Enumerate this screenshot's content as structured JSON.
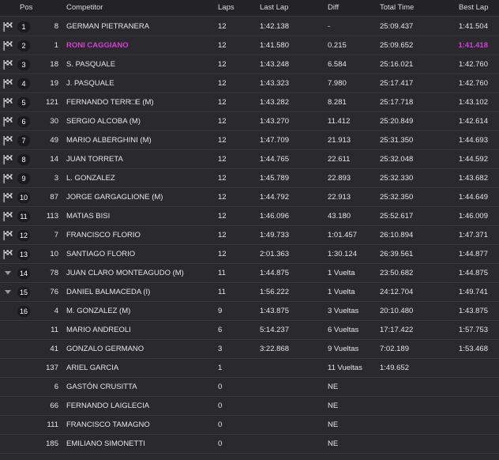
{
  "header": {
    "pos": "Pos",
    "competitor": "Competitor",
    "laps": "Laps",
    "last_lap": "Last Lap",
    "diff": "Diff",
    "total_time": "Total Time",
    "best_lap": "Best Lap"
  },
  "rows": [
    {
      "icon": "checkered-flag-icon",
      "pos": "1",
      "num": "8",
      "competitor": "GERMAN PIETRANERA",
      "laps": "12",
      "last_lap": "1:42.138",
      "diff": "-",
      "total": "25:09.437",
      "best": "1:41.504",
      "highlight": false
    },
    {
      "icon": "checkered-flag-icon",
      "pos": "2",
      "num": "1",
      "competitor": "RONI CAGGIANO",
      "laps": "12",
      "last_lap": "1:41.580",
      "diff": "0.215",
      "total": "25:09.652",
      "best": "1:41.418",
      "highlight": true
    },
    {
      "icon": "checkered-flag-icon",
      "pos": "3",
      "num": "18",
      "competitor": "S. PASQUALE",
      "laps": "12",
      "last_lap": "1:43.248",
      "diff": "6.584",
      "total": "25:16.021",
      "best": "1:42.760",
      "highlight": false
    },
    {
      "icon": "checkered-flag-icon",
      "pos": "4",
      "num": "19",
      "competitor": "J. PASQUALE",
      "laps": "12",
      "last_lap": "1:43.323",
      "diff": "7.980",
      "total": "25:17.417",
      "best": "1:42.760",
      "highlight": false
    },
    {
      "icon": "checkered-flag-icon",
      "pos": "5",
      "num": "121",
      "competitor": "FERNANDO TERR□E (M)",
      "laps": "12",
      "last_lap": "1:43.282",
      "diff": "8.281",
      "total": "25:17.718",
      "best": "1:43.102",
      "highlight": false
    },
    {
      "icon": "checkered-flag-icon",
      "pos": "6",
      "num": "30",
      "competitor": "SERGIO ALCOBA (M)",
      "laps": "12",
      "last_lap": "1:43.270",
      "diff": "11.412",
      "total": "25:20.849",
      "best": "1:42.614",
      "highlight": false
    },
    {
      "icon": "checkered-flag-icon",
      "pos": "7",
      "num": "49",
      "competitor": "MARIO ALBERGHINI (M)",
      "laps": "12",
      "last_lap": "1:47.709",
      "diff": "21.913",
      "total": "25:31.350",
      "best": "1:44.693",
      "highlight": false
    },
    {
      "icon": "checkered-flag-icon",
      "pos": "8",
      "num": "14",
      "competitor": "JUAN TORRETA",
      "laps": "12",
      "last_lap": "1:44.765",
      "diff": "22.611",
      "total": "25:32.048",
      "best": "1:44.592",
      "highlight": false
    },
    {
      "icon": "checkered-flag-icon",
      "pos": "9",
      "num": "3",
      "competitor": "L. GONZALEZ",
      "laps": "12",
      "last_lap": "1:45.789",
      "diff": "22.893",
      "total": "25:32.330",
      "best": "1:43.682",
      "highlight": false
    },
    {
      "icon": "checkered-flag-icon",
      "pos": "10",
      "num": "87",
      "competitor": "JORGE GARGAGLIONE (M)",
      "laps": "12",
      "last_lap": "1:44.792",
      "diff": "22.913",
      "total": "25:32.350",
      "best": "1:44.649",
      "highlight": false
    },
    {
      "icon": "checkered-flag-icon",
      "pos": "11",
      "num": "113",
      "competitor": "MATIAS BISI",
      "laps": "12",
      "last_lap": "1:46.096",
      "diff": "43.180",
      "total": "25:52.617",
      "best": "1:46.009",
      "highlight": false
    },
    {
      "icon": "checkered-flag-icon",
      "pos": "12",
      "num": "7",
      "competitor": "FRANCISCO FLORIO",
      "laps": "12",
      "last_lap": "1:49.733",
      "diff": "1:01.457",
      "total": "26:10.894",
      "best": "1:47.371",
      "highlight": false
    },
    {
      "icon": "checkered-flag-icon",
      "pos": "13",
      "num": "10",
      "competitor": "SANTIAGO FLORIO",
      "laps": "12",
      "last_lap": "2:01.363",
      "diff": "1:30.124",
      "total": "26:39.561",
      "best": "1:44.877",
      "highlight": false
    },
    {
      "icon": "triangle-down-icon",
      "pos": "14",
      "num": "78",
      "competitor": "JUAN CLARO MONTEAGUDO (M)",
      "laps": "11",
      "last_lap": "1:44.875",
      "diff": "1 Vuelta",
      "total": "23:50.682",
      "best": "1:44.875",
      "highlight": false
    },
    {
      "icon": "triangle-down-icon",
      "pos": "15",
      "num": "76",
      "competitor": "DANIEL BALMACEDA (I)",
      "laps": "11",
      "last_lap": "1:56.222",
      "diff": "1 Vuelta",
      "total": "24:12.704",
      "best": "1:49.741",
      "highlight": false
    },
    {
      "icon": "",
      "pos": "16",
      "num": "4",
      "competitor": "M. GONZALEZ (M)",
      "laps": "9",
      "last_lap": "1:43.875",
      "diff": "3 Vueltas",
      "total": "20:10.480",
      "best": "1:43.875",
      "highlight": false
    },
    {
      "icon": "",
      "pos": "",
      "num": "11",
      "competitor": "MARIO ANDREOLI",
      "laps": "6",
      "last_lap": "5:14.237",
      "diff": "6 Vueltas",
      "total": "17:17.422",
      "best": "1:57.753",
      "highlight": false
    },
    {
      "icon": "",
      "pos": "",
      "num": "41",
      "competitor": "GONZALO GERMANO",
      "laps": "3",
      "last_lap": "3:22.868",
      "diff": "9 Vueltas",
      "total": "7:02.189",
      "best": "1:53.468",
      "highlight": false
    },
    {
      "icon": "",
      "pos": "",
      "num": "137",
      "competitor": "ARIEL GARCIA",
      "laps": "1",
      "last_lap": "",
      "diff": "11 Vueltas",
      "total": "1:49.652",
      "best": "",
      "highlight": false
    },
    {
      "icon": "",
      "pos": "",
      "num": "6",
      "competitor": "GASTÓN CRUSITTA",
      "laps": "0",
      "last_lap": "",
      "diff": "NE",
      "total": "",
      "best": "",
      "highlight": false
    },
    {
      "icon": "",
      "pos": "",
      "num": "66",
      "competitor": "FERNANDO LAIGLECIA",
      "laps": "0",
      "last_lap": "",
      "diff": "NE",
      "total": "",
      "best": "",
      "highlight": false
    },
    {
      "icon": "",
      "pos": "",
      "num": "111",
      "competitor": "FRANCISCO TAMAGNO",
      "laps": "0",
      "last_lap": "",
      "diff": "NE",
      "total": "",
      "best": "",
      "highlight": false
    },
    {
      "icon": "",
      "pos": "",
      "num": "185",
      "competitor": "EMILIANO SIMONETTI",
      "laps": "0",
      "last_lap": "",
      "diff": "NE",
      "total": "",
      "best": "",
      "highlight": false
    }
  ]
}
